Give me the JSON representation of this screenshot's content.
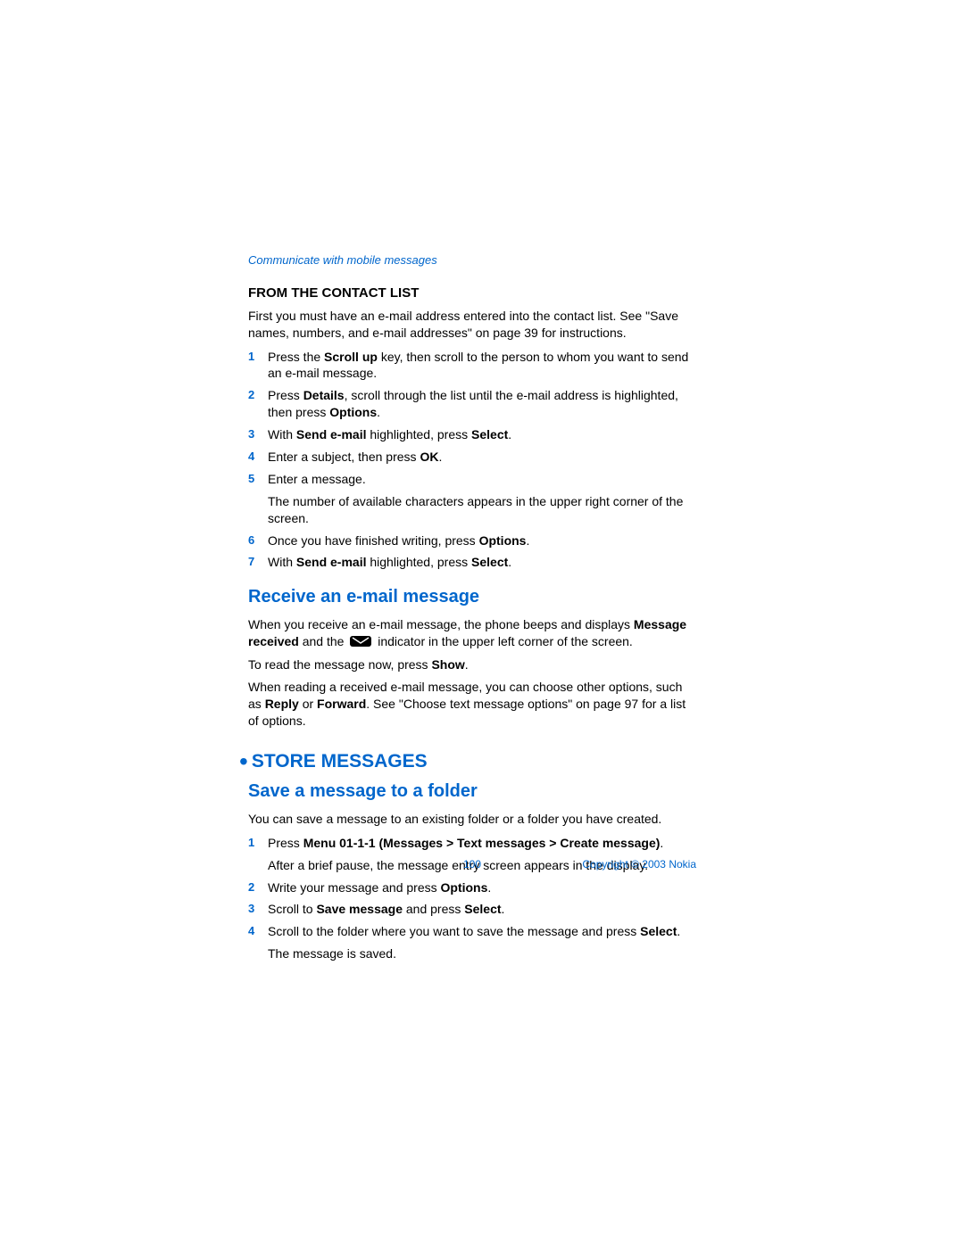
{
  "breadcrumb": "Communicate with mobile messages",
  "section1": {
    "title": "FROM THE CONTACT LIST",
    "intro": "First you must have an e-mail address entered into the contact list. See \"Save names, numbers, and e-mail addresses\" on page 39 for instructions.",
    "steps": [
      {
        "n": "1",
        "pre": "Press the ",
        "b1": "Scroll up",
        "post": " key, then scroll to the person to whom you want to send an e-mail message."
      },
      {
        "n": "2",
        "pre": "Press ",
        "b1": "Details",
        "mid": ", scroll through the list until the e-mail address is highlighted, then press ",
        "b2": "Options",
        "post": "."
      },
      {
        "n": "3",
        "pre": "With ",
        "b1": "Send e-mail",
        "mid": " highlighted, press ",
        "b2": "Select",
        "post": "."
      },
      {
        "n": "4",
        "pre": "Enter a subject, then press ",
        "b1": "OK",
        "post": "."
      },
      {
        "n": "5",
        "pre": "Enter a message.",
        "note": "The number of available characters appears in the upper right corner of the screen."
      },
      {
        "n": "6",
        "pre": "Once you have finished writing, press ",
        "b1": "Options",
        "post": "."
      },
      {
        "n": "7",
        "pre": "With ",
        "b1": "Send e-mail",
        "mid": " highlighted, press ",
        "b2": "Select",
        "post": "."
      }
    ]
  },
  "section2": {
    "title": "Receive an e-mail message",
    "p1_pre": "When you receive an e-mail message, the phone beeps and displays ",
    "p1_b1": "Message received",
    "p1_mid": " and the ",
    "p1_post": " indicator in the upper left corner of the screen.",
    "p2_pre": "To read the message now, press ",
    "p2_b": "Show",
    "p2_post": ".",
    "p3_pre": "When reading a received e-mail message, you can choose other options, such as ",
    "p3_b1": "Reply",
    "p3_mid": " or ",
    "p3_b2": "Forward",
    "p3_post": ". See \"Choose text message options\" on page 97 for a list of options."
  },
  "section3": {
    "h1": "STORE MESSAGES",
    "h2": "Save a message to a folder",
    "intro": "You can save a message to an existing folder or a folder you have created.",
    "steps": [
      {
        "n": "1",
        "pre": "Press ",
        "b1": "Menu 01-1-1 (Messages > Text messages > Create message)",
        "post": ".",
        "note": "After a brief pause, the message entry screen appears in the display."
      },
      {
        "n": "2",
        "pre": "Write your message and press ",
        "b1": "Options",
        "post": "."
      },
      {
        "n": "3",
        "pre": "Scroll to ",
        "b1": "Save message",
        "mid": " and press ",
        "b2": "Select",
        "post": "."
      },
      {
        "n": "4",
        "pre": "Scroll to the folder where you want to save the message and press ",
        "b1": "Select",
        "post": ".",
        "note": "The message is saved."
      }
    ]
  },
  "footer": {
    "page": "100",
    "copyright": "Copyright © 2003 Nokia"
  }
}
